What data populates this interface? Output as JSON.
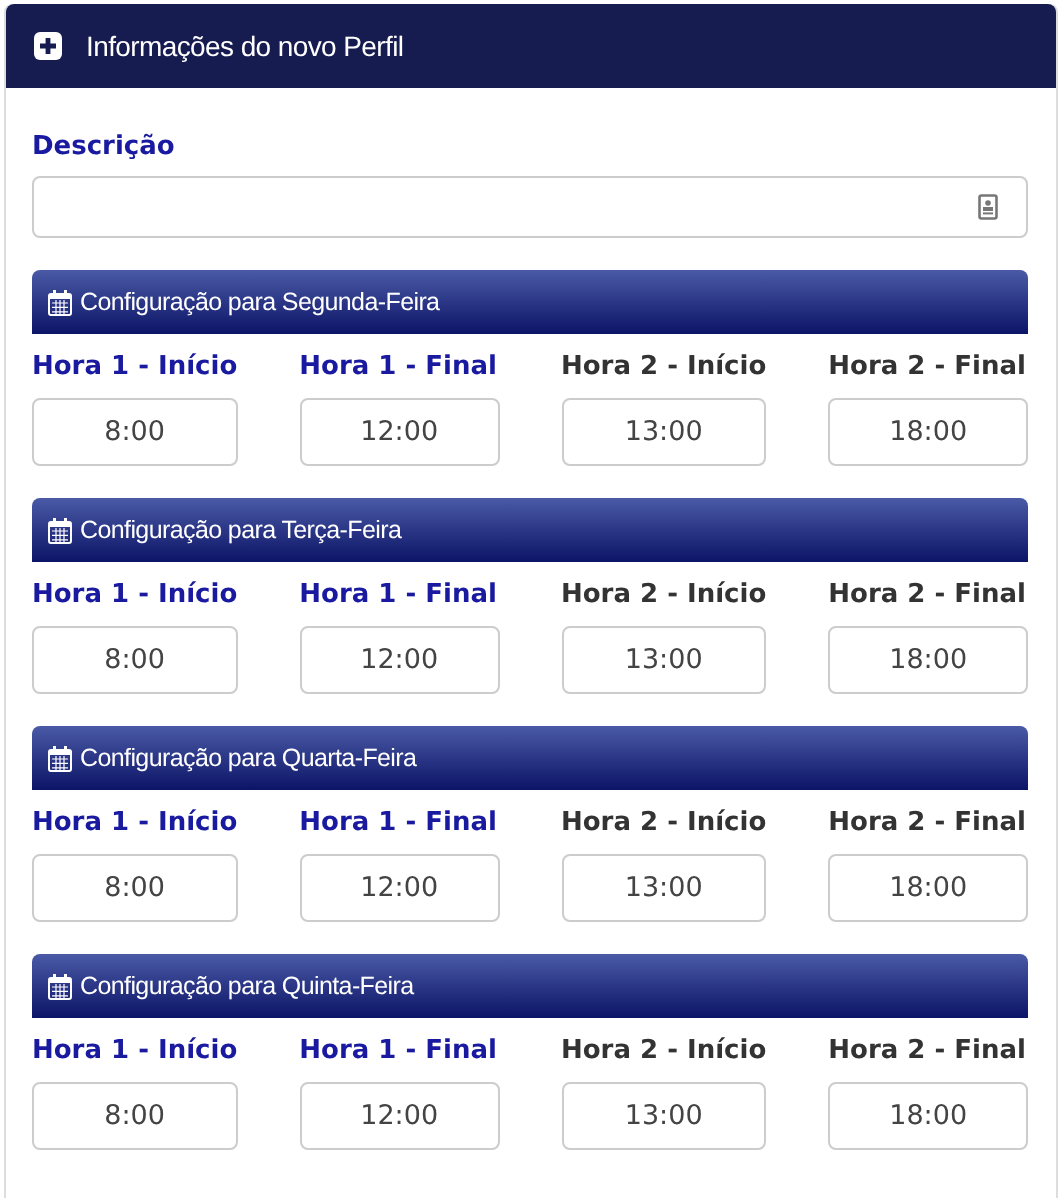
{
  "panel": {
    "title": "Informações do novo Perfil"
  },
  "description": {
    "label": "Descrição"
  },
  "days": [
    {
      "title": "Configuração para Segunda-Feira",
      "fields": [
        {
          "label": "Hora 1 - Início",
          "color": "#1a1aa0",
          "value": "8:00"
        },
        {
          "label": "Hora 1 - Final",
          "color": "#1a1aa0",
          "value": "12:00"
        },
        {
          "label": "Hora 2 - Início",
          "color": "#333333",
          "value": "13:00"
        },
        {
          "label": "Hora 2 - Final",
          "color": "#333333",
          "value": "18:00"
        }
      ]
    },
    {
      "title": "Configuração para Terça-Feira",
      "fields": [
        {
          "label": "Hora 1 - Início",
          "color": "#1a1aa0",
          "value": "8:00"
        },
        {
          "label": "Hora 1 - Final",
          "color": "#1a1aa0",
          "value": "12:00"
        },
        {
          "label": "Hora 2 - Início",
          "color": "#333333",
          "value": "13:00"
        },
        {
          "label": "Hora 2 - Final",
          "color": "#333333",
          "value": "18:00"
        }
      ]
    },
    {
      "title": "Configuração para Quarta-Feira",
      "fields": [
        {
          "label": "Hora 1 - Início",
          "color": "#1a1aa0",
          "value": "8:00"
        },
        {
          "label": "Hora 1 - Final",
          "color": "#1a1aa0",
          "value": "12:00"
        },
        {
          "label": "Hora 2 - Início",
          "color": "#333333",
          "value": "13:00"
        },
        {
          "label": "Hora 2 - Final",
          "color": "#333333",
          "value": "18:00"
        }
      ]
    },
    {
      "title": "Configuração para Quinta-Feira",
      "fields": [
        {
          "label": "Hora 1 - Início",
          "color": "#1a1aa0",
          "value": "8:00"
        },
        {
          "label": "Hora 1 - Final",
          "color": "#1a1aa0",
          "value": "12:00"
        },
        {
          "label": "Hora 2 - Início",
          "color": "#333333",
          "value": "13:00"
        },
        {
          "label": "Hora 2 - Final",
          "color": "#333333",
          "value": "18:00"
        }
      ]
    }
  ]
}
